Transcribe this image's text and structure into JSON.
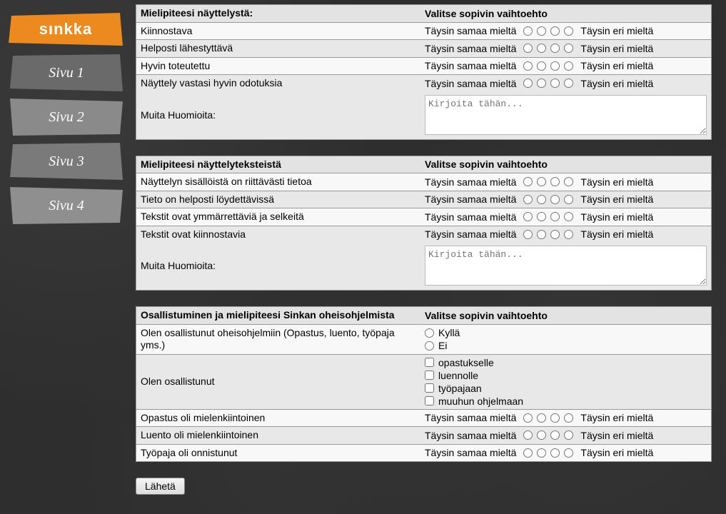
{
  "logo_text": "sınkka",
  "nav": [
    {
      "label": "Sivu 1",
      "fill": "#6a6a6a"
    },
    {
      "label": "Sivu 2",
      "fill": "#8a8a8a"
    },
    {
      "label": "Sivu 3",
      "fill": "#7a7a7a"
    },
    {
      "label": "Sivu 4",
      "fill": "#8f8f8f"
    }
  ],
  "likert": {
    "left": "Täysin samaa mieltä",
    "right": "Täysin eri mieltä"
  },
  "section1": {
    "header_q": "Mielipiteesi näyttelystä:",
    "header_a": "Valitse sopivin vaihtoehto",
    "rows": [
      "Kiinnostava",
      "Helposti lähestyttävä",
      "Hyvin toteutettu",
      "Näyttely vastasi hyvin odotuksia"
    ],
    "notes_label": "Muita Huomioita:",
    "notes_placeholder": "Kirjoita tähän..."
  },
  "section2": {
    "header_q": "Mielipiteesi näyttelyteksteistä",
    "header_a": "Valitse sopivin vaihtoehto",
    "rows": [
      "Näyttelyn sisällöistä on riittävästi tietoa",
      "Tieto on helposti löydettävissä",
      "Tekstit ovat ymmärrettäviä ja selkeitä",
      "Tekstit ovat kiinnostavia"
    ],
    "notes_label": "Muita Huomioita:",
    "notes_placeholder": "Kirjoita tähän..."
  },
  "section3": {
    "header_q": "Osallistuminen ja mielipiteesi Sinkan oheisohjelmista",
    "header_a": "Valitse sopivin vaihtoehto",
    "q_participated": "Olen osallistunut oheisohjelmiin (Opastus, luento, työpaja yms.)",
    "yesno": {
      "yes": "Kyllä",
      "no": "Ei"
    },
    "q_types": "Olen osallistunut",
    "types": [
      "opastukselle",
      "luennolle",
      "työpajaan",
      "muuhun ohjelmaan"
    ],
    "likert_rows": [
      "Opastus oli mielenkiintoinen",
      "Luento oli mielenkiintoinen",
      "Työpaja oli onnistunut"
    ]
  },
  "submit_label": "Lähetä"
}
